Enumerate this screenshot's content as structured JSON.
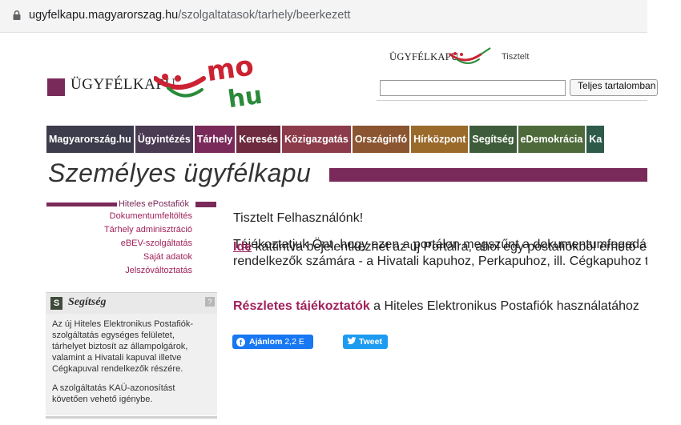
{
  "browser": {
    "url_domain": "ugyfelkapu.magyarorszag.hu",
    "url_path": "/szolgaltatasok/tarhely/beerkezett",
    "lock_icon": "lock-icon"
  },
  "header": {
    "logo_text": "ÜGYFÉLKAPU",
    "logo_art_text_top": "mo",
    "logo_art_text_bottom": "hu",
    "small_logo_text": "ÜGYFÉLKAPU",
    "greeting": "Tisztelt",
    "search_placeholder": "",
    "search_button": "Teljes tartalomban"
  },
  "nav": {
    "items": [
      {
        "label": "Magyarország.hu",
        "color": "#3c3c4c"
      },
      {
        "label": "Ügyintézés",
        "color": "#4a3a52"
      },
      {
        "label": "Tárhely",
        "color": "#7a2a5a"
      },
      {
        "label": "Keresés",
        "color": "#6e2a3e"
      },
      {
        "label": "Közigazgatás",
        "color": "#8c3b4a"
      },
      {
        "label": "Országinfó",
        "color": "#8a5530"
      },
      {
        "label": "Hírközpont",
        "color": "#9a6a2a"
      },
      {
        "label": "Segítség",
        "color": "#3e5c3a"
      },
      {
        "label": "eDemokrácia",
        "color": "#4e6a3a"
      },
      {
        "label": "Ka",
        "color": "#2e5a4a"
      }
    ]
  },
  "page": {
    "title": "Személyes ügyfélkapu"
  },
  "sidebar": {
    "active_item": "Hiteles ePostafiók",
    "items": [
      "Dokumentumfeltöltés",
      "Tárhely adminisztráció",
      "eBEV-szolgáltatás",
      "Saját adatok",
      "Jelszóváltoztatás"
    ]
  },
  "help": {
    "badge": "S",
    "title": "Segítség",
    "question_mark": "?",
    "paragraph1": "Az új Hiteles Elektronikus Postafiók-szolgáltatás egységes felületet, tárhelyet biztosít az állampolgárok, valamint a Hivatali kapuval illetve Cégkapuval rendelkezők részére.",
    "paragraph2": "A szolgáltatás KAÜ-azonosítást követően vehető igénybe."
  },
  "main": {
    "salutation": "Tisztelt Felhasználónk!",
    "notice": "Tájékoztatjuk Önt, hogy ezen a portálon megszűnt a dokumentumfogadás és -küldés.",
    "link_here": "Ide",
    "here_text_line1": " kattintva bejelentkezhet az új Portálra, ahol egy postafiókból érhető el a személyes tárhelye, valamint",
    "here_text_line2": "rendelkezők számára - a Hivatali kapuhoz, Perkapuhoz, ill. Cégkapuhoz tartozó tárhelyek.",
    "details_link": "Részletes tájékoztatók",
    "details_text": " a Hiteles Elektronikus Postafiók használatához"
  },
  "social": {
    "facebook_label": "Ajánlom",
    "facebook_count": "2,2 E",
    "facebook_icon": "facebook-icon",
    "tweet_label": "Tweet",
    "tweet_icon": "twitter-bird-icon"
  }
}
